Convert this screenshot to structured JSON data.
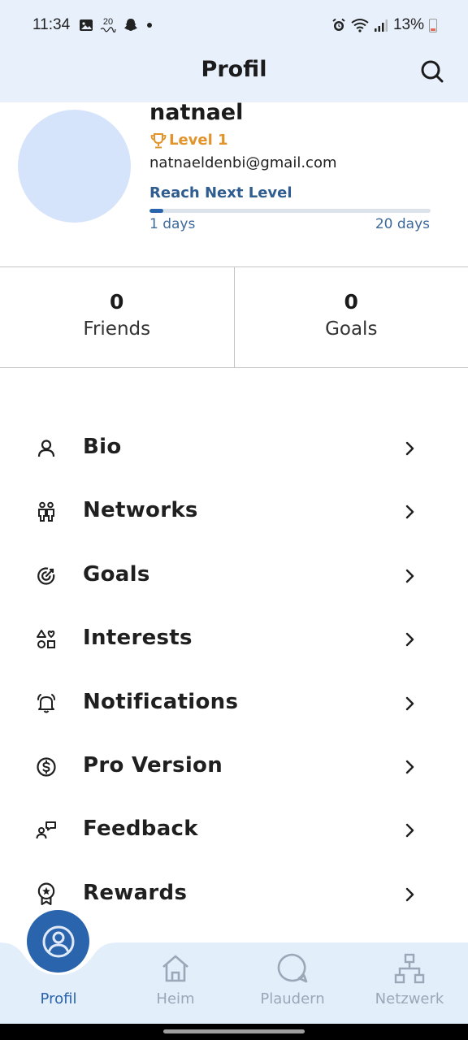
{
  "status_bar": {
    "time": "11:34",
    "left_icons": [
      "image-icon",
      "calendar-date-icon",
      "snapchat-icon",
      "dot-icon"
    ],
    "calendar_text": "20",
    "battery": "13%",
    "right_icons": [
      "alarm-icon",
      "wifi-icon",
      "signal-icon",
      "battery-icon"
    ]
  },
  "app_bar": {
    "title": "Profil",
    "search_icon": "search-icon"
  },
  "profile": {
    "username": "natnael",
    "level": "Level 1",
    "email": "natnaeldenbi@gmail.com",
    "reach_label": "Reach Next Level",
    "progress_fraction": 0.05,
    "days_current": "1 days",
    "days_target": "20 days"
  },
  "stats": [
    {
      "value": "0",
      "label": "Friends"
    },
    {
      "value": "0",
      "label": "Goals"
    }
  ],
  "menu": [
    {
      "label": "Bio",
      "icon": "user-icon"
    },
    {
      "label": "Networks",
      "icon": "people-icon"
    },
    {
      "label": "Goals",
      "icon": "target-icon"
    },
    {
      "label": "Interests",
      "icon": "shapes-icon"
    },
    {
      "label": "Notifications",
      "icon": "bell-icon"
    },
    {
      "label": "Pro Version",
      "icon": "dollar-icon"
    },
    {
      "label": "Feedback",
      "icon": "feedback-icon"
    },
    {
      "label": "Rewards",
      "icon": "award-icon"
    }
  ],
  "bottom_nav": [
    {
      "label": "Profil",
      "icon": "user-circle-icon",
      "active": true
    },
    {
      "label": "Heim",
      "icon": "home-icon",
      "active": false
    },
    {
      "label": "Plaudern",
      "icon": "chat-icon",
      "active": false
    },
    {
      "label": "Netzwerk",
      "icon": "network-icon",
      "active": false
    }
  ],
  "colors": {
    "primary": "#2a64ad",
    "header_bg": "#e8f0fb",
    "level_orange": "#e2932a",
    "avatar_bg": "#d6e4fb",
    "nav_inactive": "#9aa7b6"
  }
}
